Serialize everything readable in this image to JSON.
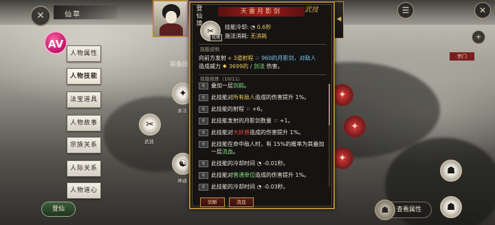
{
  "header": {
    "character_name": "仙草",
    "close_icon_glyph": "✕",
    "top_right_buttons": [
      "☰",
      "✕"
    ]
  },
  "left_menu": {
    "logo_text": "AV",
    "items": [
      {
        "label": "人物属性",
        "active": false
      },
      {
        "label": "人物技能",
        "active": true
      },
      {
        "label": "法宝道具",
        "active": false
      },
      {
        "label": "人物故事",
        "active": false
      },
      {
        "label": "宗族关系",
        "active": false
      },
      {
        "label": "人际关系",
        "active": false
      },
      {
        "label": "人物道心",
        "active": false
      }
    ]
  },
  "board": {
    "equip_label": "装备技",
    "skills": [
      {
        "name": "身法",
        "glyph": "✦"
      },
      {
        "name": "武技",
        "glyph": "✂"
      },
      {
        "name": "神通",
        "glyph": "☯"
      }
    ],
    "bottom_left_label": "登仙",
    "view_attributes_label": "查看属性",
    "right_tag": "宗门"
  },
  "tooltip": {
    "side_title": "登仙境",
    "title": "天雷月影剑",
    "type_mark": "武技",
    "medal_tag": "化境",
    "cooldown_label": "技能冷却:",
    "cooldown_value": "0.6秒",
    "cost_label": "施法消耗:",
    "cost_value": "无消耗",
    "desc_head": "技能说明",
    "desc_line1_a": "向前方发射",
    "desc_line1_b": "3道射程",
    "desc_line1_c": "960的月影剑，对敌人",
    "desc_line2_a": "造成威力",
    "desc_line2_b": "3699的",
    "desc_line2_c": "剑法",
    "desc_line2_d": "伤害。",
    "mods_head": "技能修炼（10/11）",
    "mods": [
      {
        "badge": "化",
        "pre": "叠加一层",
        "hl": "剑韵",
        "hl_class": "green",
        "post": "。"
      },
      {
        "badge": "化",
        "pre": "此技能对",
        "hl": "所有敌人",
        "hl_class": "gold",
        "post": "造成的伤害提升 1%。"
      },
      {
        "badge": "化",
        "pre": "此技能的射程 ⁙ +6。",
        "hl": "",
        "hl_class": "",
        "post": ""
      },
      {
        "badge": "化",
        "pre": "此技能发射的月影剑数量 ⁙ +1。",
        "hl": "",
        "hl_class": "",
        "post": ""
      },
      {
        "badge": "化",
        "pre": "此技能对",
        "hl": "大妖兽",
        "hl_class": "red",
        "post": "造成的伤害提升 1%。"
      },
      {
        "badge": "化",
        "pre": "此技能在命中敌人时，有 15%的概率为其叠加一层",
        "hl": "流血",
        "hl_class": "green",
        "post": "。"
      },
      {
        "badge": "化",
        "pre": "此技能的冷却时间 ◔ -0.01秒。",
        "hl": "",
        "hl_class": "",
        "post": ""
      },
      {
        "badge": "化",
        "pre": "此技能对",
        "hl": "普通单位",
        "hl_class": "green",
        "post": "造成的伤害提升 1%。"
      },
      {
        "badge": "化",
        "pre": "此技能的冷却时间 ◔ -0.03秒。",
        "hl": "",
        "hl_class": "",
        "post": ""
      }
    ],
    "btn_left": "剑斩",
    "btn_right": "流血"
  }
}
